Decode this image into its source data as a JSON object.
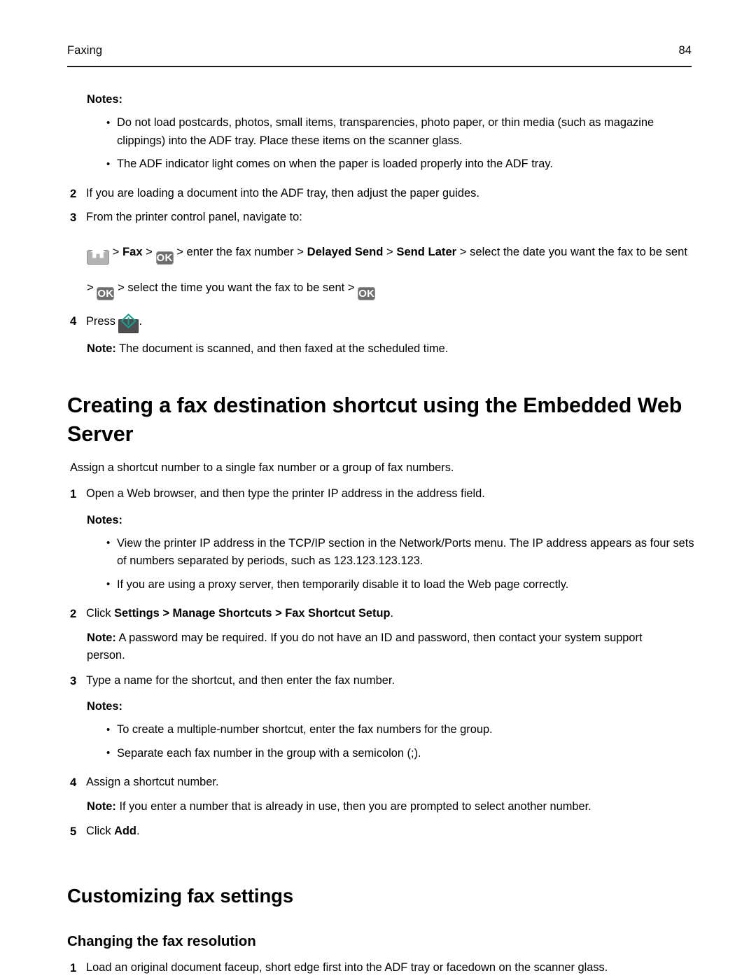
{
  "header": {
    "section_title": "Faxing",
    "page_number": "84"
  },
  "top_section": {
    "notes_label": "Notes:",
    "notes": [
      "Do not load postcards, photos, small items, transparencies, photo paper, or thin media (such as magazine clippings) into the ADF tray. Place these items on the scanner glass.",
      "The ADF indicator light comes on when the paper is loaded properly into the ADF tray."
    ],
    "step2_num": "2",
    "step2_text": "If you are loading a document into the ADF tray, then adjust the paper guides.",
    "step3_num": "3",
    "step3_text": "From the printer control panel, navigate to:",
    "navpath": {
      "home_icon_label": "home-icon",
      "sep1": ">",
      "fax_label": "Fax",
      "sep2": ">",
      "ok1_label": "OK",
      "enter_fax_number": "> enter the fax number >",
      "delayed_send_label": "Delayed Send",
      "sep3": ">",
      "send_later_label": "Send Later",
      "select_date_text": "> select the date you want the fax to be sent >",
      "ok2_label": "OK",
      "select_time_text": "> select the time you want the fax to be sent >",
      "ok3_label": "OK"
    },
    "step4_num": "4",
    "step4_press_label": "Press",
    "step4_start_icon_label": "start-icon",
    "step4_period": ".",
    "step4_note_label": "Note:",
    "step4_note_text": "The document is scanned, and then faxed at the scheduled time."
  },
  "section_shortcut": {
    "heading": "Creating a fax destination shortcut using the Embedded Web Server",
    "intro": "Assign a shortcut number to a single fax number or a group of fax numbers.",
    "step1_num": "1",
    "step1_text": "Open a Web browser, and then type the printer IP address in the address field.",
    "notes1_label": "Notes:",
    "notes1": [
      "View the printer IP address in the TCP/IP section in the Network/Ports menu. The IP address appears as four sets of numbers separated by periods, such as 123.123.123.123.",
      "If you are using a proxy server, then temporarily disable it to load the Web page correctly."
    ],
    "step2_num": "2",
    "step2_click": "Click",
    "step2_settings": "Settings",
    "step2_sep1": ">",
    "step2_manage_shortcuts": "Manage Shortcuts",
    "step2_sep2": ">",
    "step2_fax_shortcut_setup": "Fax Shortcut Setup",
    "step2_period": ".",
    "step2_note_label": "Note:",
    "step2_note_text": "A password may be required. If you do not have an ID and password, then contact your system support person.",
    "step3_num": "3",
    "step3_text": "Type a name for the shortcut, and then enter the fax number.",
    "notes2_label": "Notes:",
    "notes2": [
      "To create a multiple-number shortcut, enter the fax numbers for the group.",
      "Separate each fax number in the group with a semicolon (;)."
    ],
    "step4_num": "4",
    "step4_text": "Assign a shortcut number.",
    "step4_note_label": "Note:",
    "step4_note_text": "If you enter a number that is already in use, then you are prompted to select another number.",
    "step5_num": "5",
    "step5_click": "Click",
    "step5_add": "Add",
    "step5_period": "."
  },
  "section_customizing": {
    "heading": "Customizing fax settings",
    "subheading": "Changing the fax resolution",
    "step1_num": "1",
    "step1_text": "Load an original document faceup, short edge first into the ADF tray or facedown on the scanner glass."
  },
  "colors": {
    "text": "#000000",
    "rule": "#1a1a1a",
    "home_icon_bg": "#b3b3b3",
    "ok_icon_bg": "#6e6e6e",
    "start_icon_bg": "#4d4d4d",
    "start_icon_accent": "#17a08f"
  }
}
